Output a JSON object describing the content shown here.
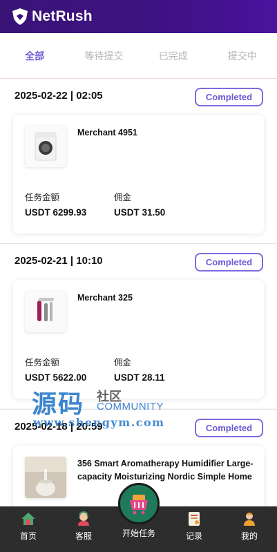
{
  "app": {
    "name": "NetRush"
  },
  "tabs": [
    {
      "label": "全部",
      "active": true
    },
    {
      "label": "等待提交",
      "active": false
    },
    {
      "label": "已完成",
      "active": false
    },
    {
      "label": "提交中",
      "active": false
    }
  ],
  "orders": [
    {
      "date": "2025-02-22 | 02:05",
      "status": "Completed",
      "merchant": "Merchant 4951",
      "amount_label": "任务金额",
      "amount": "USDT 6299.93",
      "commission_label": "佣金",
      "commission": "USDT 31.50",
      "product_icon": "washing-machine-icon"
    },
    {
      "date": "2025-02-21 | 10:10",
      "status": "Completed",
      "merchant": "Merchant 325",
      "amount_label": "任务金额",
      "amount": "USDT 5622.00",
      "commission_label": "佣金",
      "commission": "USDT 28.11",
      "product_icon": "hair-styler-icon"
    },
    {
      "date": "2025-02-18 | 20:59",
      "status": "Completed",
      "merchant": "356 Smart Aromatherapy Humidifier Large-capacity Moisturizing Nordic Simple Home",
      "product_icon": "humidifier-icon"
    }
  ],
  "watermark": {
    "big": "源码",
    "small": "社区",
    "english": "COMMUNITY",
    "url": "www.shengym.com"
  },
  "bottom_nav": {
    "home": "首页",
    "service": "客服",
    "start_task": "开始任务",
    "records": "记录",
    "mine": "我的"
  },
  "colors": {
    "header": "#3d1281",
    "accent": "#6a5bd6",
    "nav_bg": "#2d2d2d",
    "fab": "#1f7a5a"
  }
}
